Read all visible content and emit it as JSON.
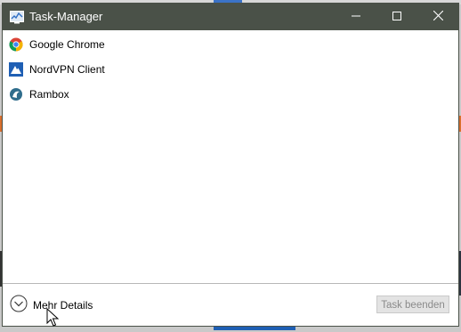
{
  "window": {
    "title": "Task-Manager",
    "icon": "task-manager-icon",
    "controls": [
      "minimize-icon",
      "maximize-icon",
      "close-icon"
    ]
  },
  "apps": [
    {
      "label": "Google Chrome",
      "icon": "chrome-icon"
    },
    {
      "label": "NordVPN Client",
      "icon": "nordvpn-icon"
    },
    {
      "label": "Rambox",
      "icon": "rambox-icon"
    }
  ],
  "footer": {
    "details_label": "Mehr Details",
    "end_task_label": "Task beenden"
  },
  "colors": {
    "titlebar": "#4a5148",
    "window_bg": "#ffffff",
    "button_disabled": "#e3e3e3"
  }
}
